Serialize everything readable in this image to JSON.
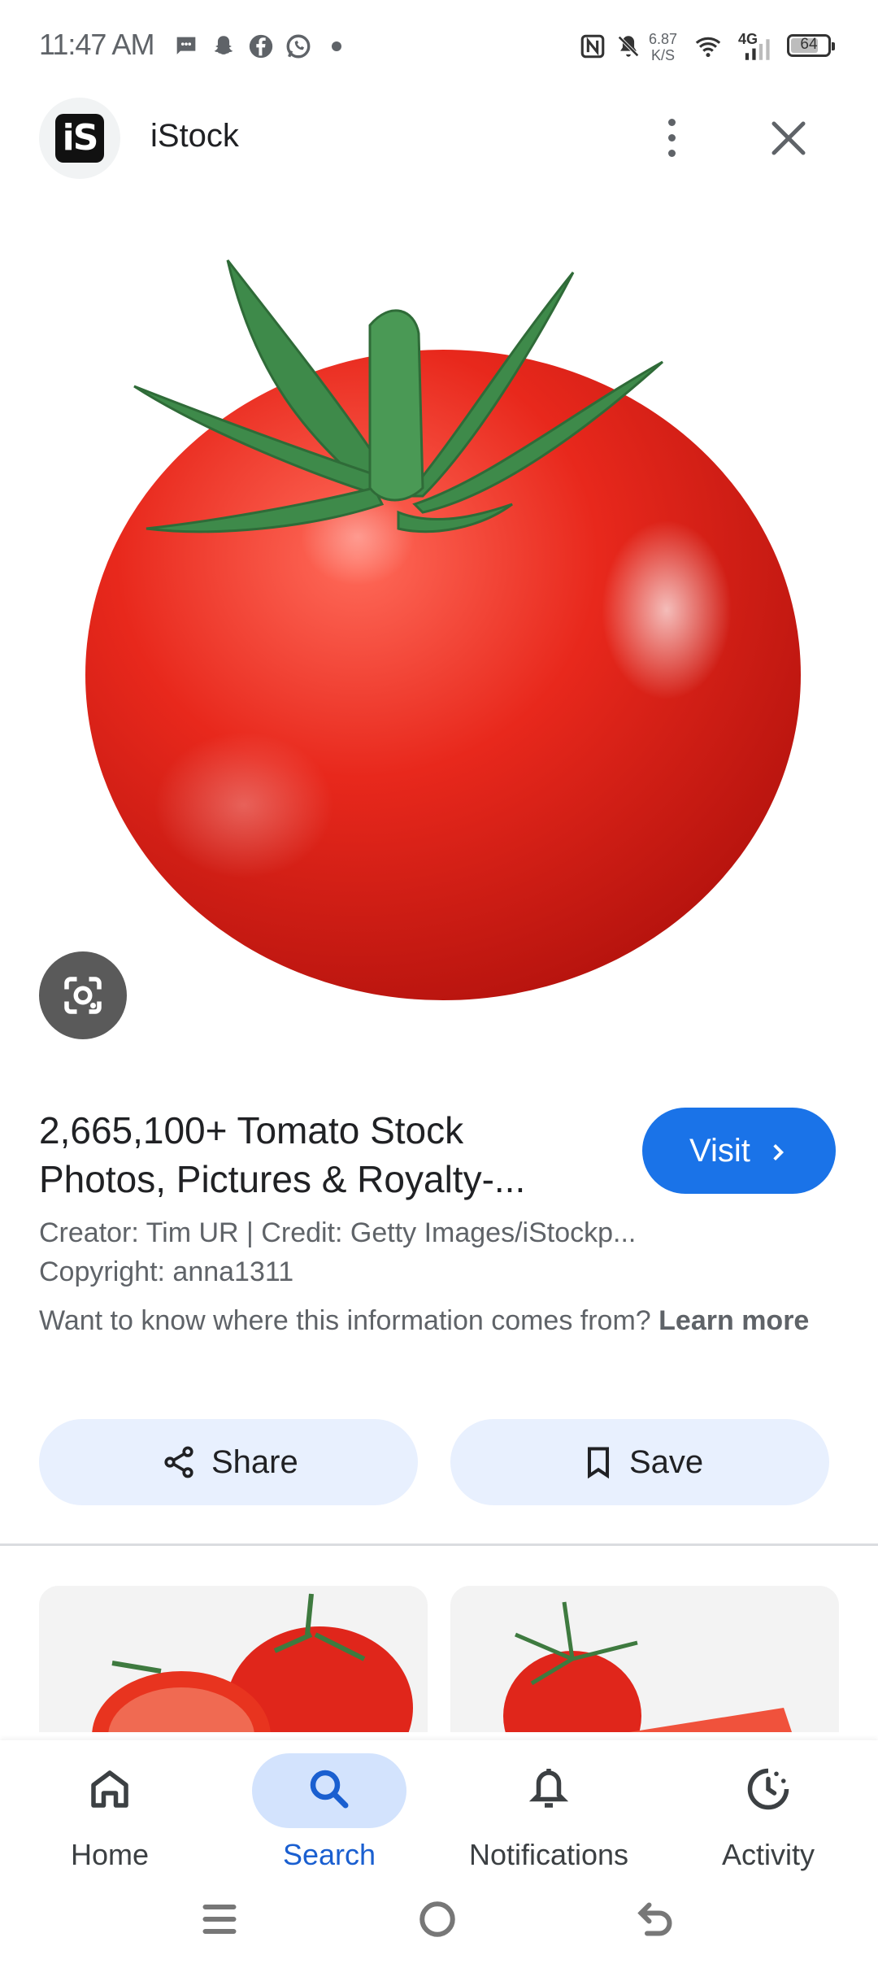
{
  "status_bar": {
    "time": "11:47 AM",
    "speed_value": "6.87",
    "speed_unit": "K/S",
    "network": "4G",
    "battery": "64",
    "icons": [
      "messages-icon",
      "snapchat-icon",
      "facebook-icon",
      "whatsapp-icon",
      "nfc-icon",
      "mute-icon",
      "wifi-icon",
      "signal-icon",
      "battery-icon"
    ]
  },
  "header": {
    "site_name": "iStock",
    "logo_text": "iS"
  },
  "result": {
    "title_line1": "2,665,100+ Tomato Stock",
    "title_line2": "Photos, Pictures & Royalty-...",
    "visit_label": "Visit",
    "creator": "Creator: Tim UR | Credit: Getty Images/iStockp...",
    "copyright": "Copyright: anna1311",
    "info_text": "Want to know where this information comes from?",
    "learn_more": "Learn more",
    "share_label": "Share",
    "save_label": "Save"
  },
  "bottom_nav": {
    "items": [
      {
        "label": "Home",
        "icon": "home-icon",
        "selected": false
      },
      {
        "label": "Search",
        "icon": "search-icon",
        "selected": true
      },
      {
        "label": "Notifications",
        "icon": "bell-icon",
        "selected": false
      },
      {
        "label": "Activity",
        "icon": "activity-icon",
        "selected": false
      }
    ]
  },
  "colors": {
    "accent": "#1a73e8",
    "pill_bg": "#e8f0fe",
    "selected_pill": "#d3e3fd",
    "tomato": "#e53935"
  }
}
